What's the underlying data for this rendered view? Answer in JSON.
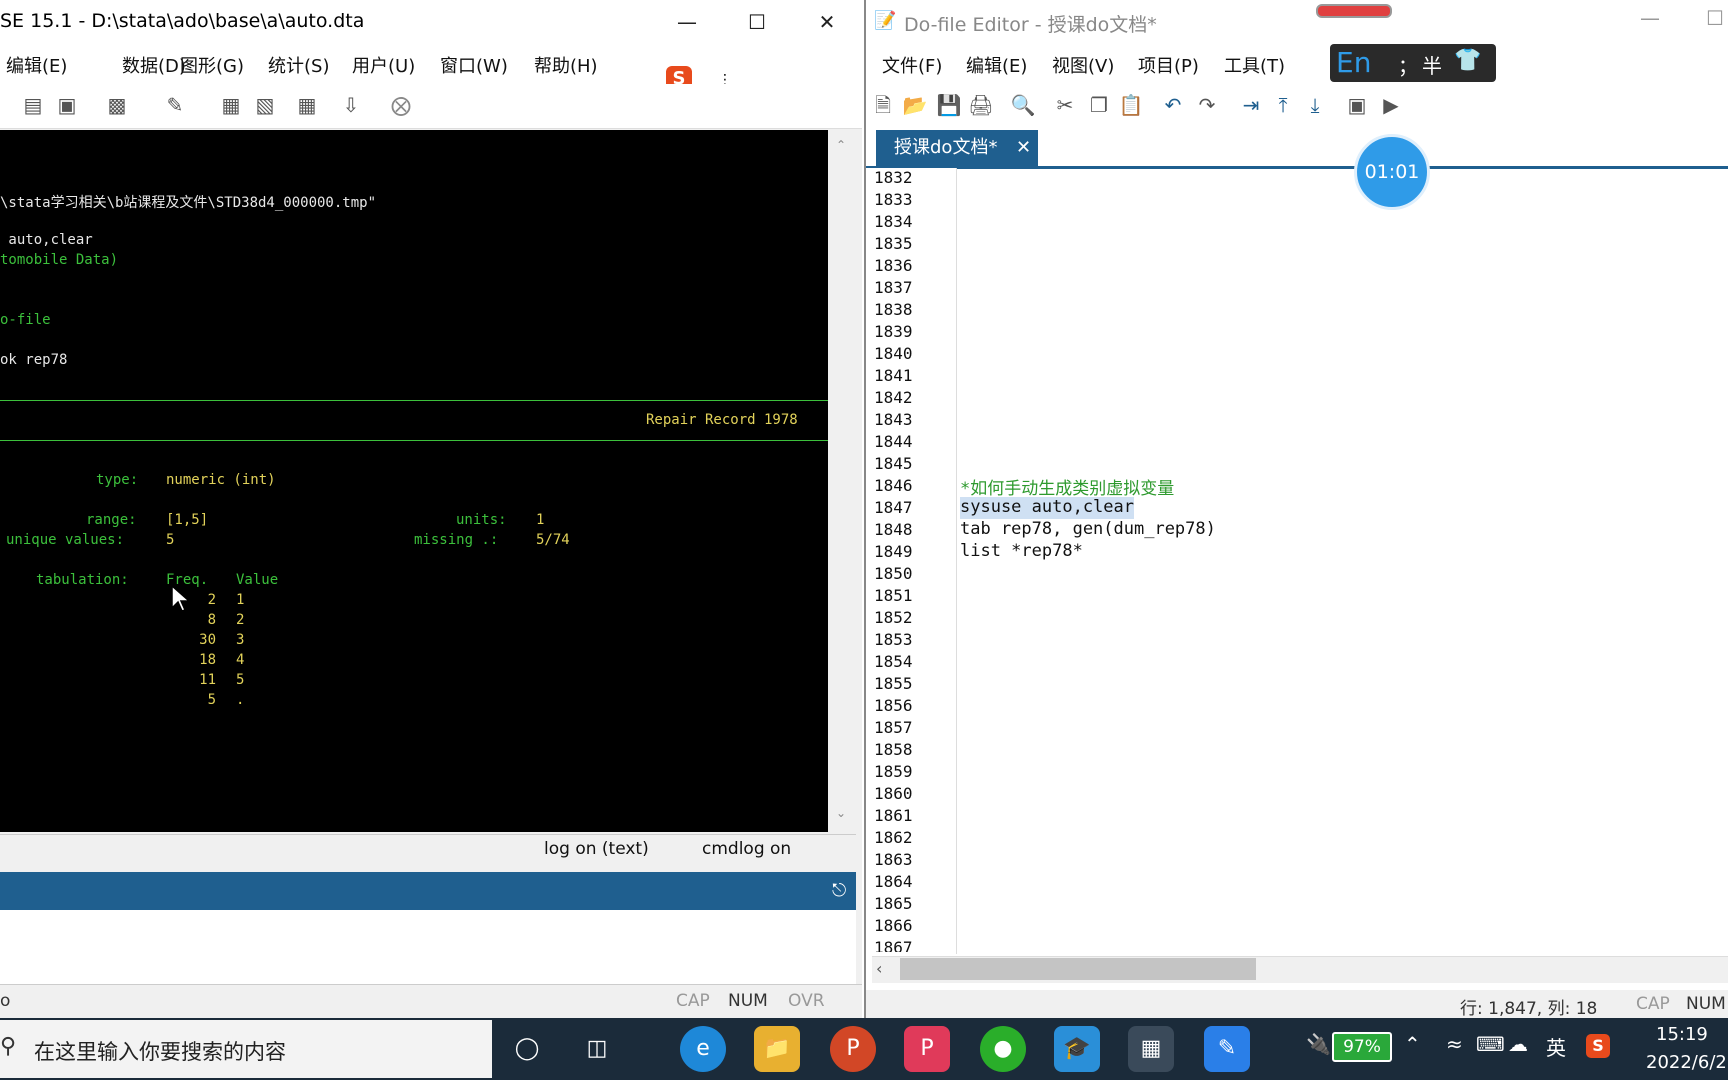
{
  "stata": {
    "title": "SE 15.1 - D:\\stata\\ado\\base\\a\\auto.dta",
    "menu": [
      "编辑(E)",
      "数据(D)",
      "图形(G)",
      "统计(S)",
      "用户(U)",
      "窗口(W)",
      "帮助(H)"
    ],
    "results": {
      "path_line": "\\stata学习相关\\b站课程及文件\\STD38d4_000000.tmp\"",
      "cmd1": " auto,clear",
      "dataset": "tomobile Data)",
      "dofile": "o-file",
      "cmd2": "ok rep78",
      "var_label": "Repair Record 1978",
      "type_label": "type:",
      "type_value": "numeric (int)",
      "range_label": "range:",
      "range_value": "[1,5]",
      "units_label": "units:",
      "units_value": "1",
      "unique_label": "unique values:",
      "unique_value": "5",
      "missing_label": "missing .:",
      "missing_value": "5/74",
      "tab_label": "tabulation:",
      "freq_header": "Freq.",
      "value_header": "Value",
      "rows": [
        {
          "freq": "2",
          "value": "1"
        },
        {
          "freq": "8",
          "value": "2"
        },
        {
          "freq": "30",
          "value": "3"
        },
        {
          "freq": "18",
          "value": "4"
        },
        {
          "freq": "11",
          "value": "5"
        },
        {
          "freq": "5",
          "value": "."
        }
      ]
    },
    "log_status": "log on (text)",
    "cmdlog_status": "cmdlog on",
    "status_left": "o",
    "status_cap": "CAP",
    "status_num": "NUM",
    "status_ovr": "OVR"
  },
  "dofile": {
    "title": "Do-file Editor - 授课do文档*",
    "menu": [
      "文件(F)",
      "编辑(E)",
      "视图(V)",
      "项目(P)",
      "工具(T)"
    ],
    "tab_label": "授课do文档*",
    "tab_close": "✕",
    "line_numbers": [
      "1832",
      "1833",
      "1834",
      "1835",
      "1836",
      "1837",
      "1838",
      "1839",
      "1840",
      "1841",
      "1842",
      "1843",
      "1844",
      "1845",
      "1846",
      "1847",
      "1848",
      "1849",
      "1850",
      "1851",
      "1852",
      "1853",
      "1854",
      "1855",
      "1856",
      "1857",
      "1858",
      "1859",
      "1860",
      "1861",
      "1862",
      "1863",
      "1864",
      "1865",
      "1866",
      "1867"
    ],
    "code": {
      "comment": "*如何手动生成类别虚拟变量",
      "line_1847": "sysuse auto,clear",
      "line_1848": "tab rep78, gen(dum_rep78)",
      "line_1849": "list *rep78*"
    },
    "status_pos": "行: 1,847, 列: 18",
    "status_cap": "CAP",
    "status_num": "NUM"
  },
  "ime": {
    "lang": "En",
    "punct": "；",
    "width": "半"
  },
  "timer": "01:01",
  "taskbar": {
    "search_placeholder": "在这里输入你要搜索的内容",
    "battery": "97%",
    "ime_lang": "英",
    "time": "15:19",
    "date": "2022/6/2"
  },
  "colors": {
    "accent_blue": "#1f5f8f",
    "results_green": "#3cc03c",
    "results_yellow": "#e2d25a",
    "code_comment": "#2e9a2e",
    "taskbar": "#1b2b3a"
  }
}
